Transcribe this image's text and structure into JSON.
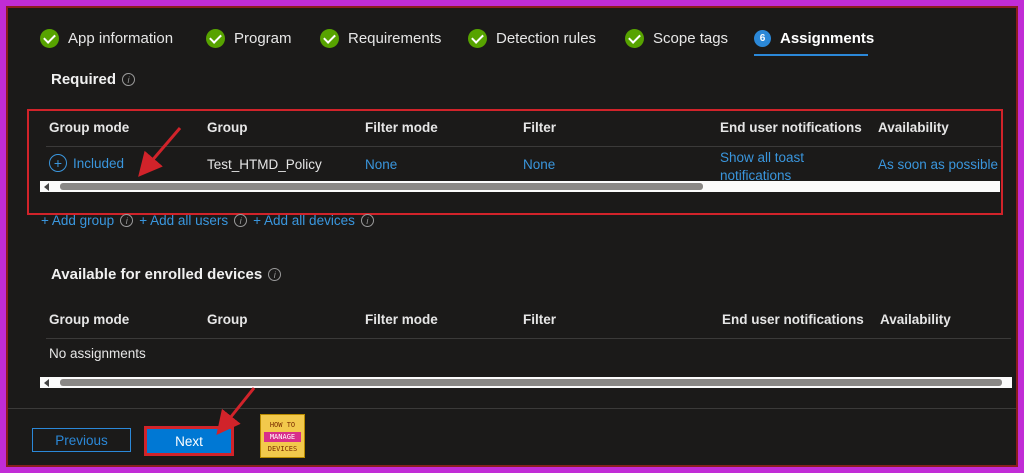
{
  "wizard": {
    "steps": [
      {
        "label": "App information",
        "state": "complete"
      },
      {
        "label": "Program",
        "state": "complete"
      },
      {
        "label": "Requirements",
        "state": "complete"
      },
      {
        "label": "Detection rules",
        "state": "complete"
      },
      {
        "label": "Scope tags",
        "state": "complete"
      },
      {
        "label": "Assignments",
        "state": "active",
        "number": "6"
      }
    ]
  },
  "required": {
    "title": "Required",
    "columns": [
      "Group mode",
      "Group",
      "Filter mode",
      "Filter",
      "End user notifications",
      "Availability"
    ],
    "row": {
      "group_mode": "Included",
      "group": "Test_HTMD_Policy",
      "filter_mode": "None",
      "filter": "None",
      "end_user_notifications_line1": "Show all toast",
      "end_user_notifications_line2": "notifications",
      "availability": "As soon as possible"
    },
    "add_group": "+ Add group",
    "add_all_users": "+ Add all users",
    "add_all_devices": "+ Add all devices"
  },
  "available": {
    "title": "Available for enrolled devices",
    "columns": [
      "Group mode",
      "Group",
      "Filter mode",
      "Filter",
      "End user notifications",
      "Availability"
    ],
    "empty_text": "No assignments"
  },
  "footer": {
    "previous_label": "Previous",
    "next_label": "Next",
    "logo_line1": "HOW TO",
    "logo_line2": "MANAGE",
    "logo_line3": "DEVICES"
  },
  "colors": {
    "accent": "#2b88d8",
    "complete": "#57a300",
    "annotation": "#d1232a",
    "background": "#1b1a19",
    "border": "#c12cd6"
  }
}
